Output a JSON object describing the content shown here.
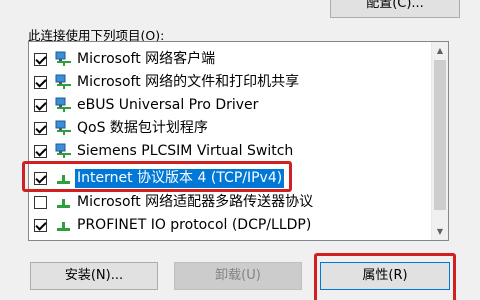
{
  "top_button": {
    "label": "配置(C)..."
  },
  "caption": "此连接使用下列项目(O):",
  "items": [
    {
      "label": "Microsoft 网络客户端",
      "checked": true,
      "icon": "network-client-icon"
    },
    {
      "label": "Microsoft 网络的文件和打印机共享",
      "checked": true,
      "icon": "network-client-icon"
    },
    {
      "label": "eBUS Universal Pro Driver",
      "checked": true,
      "icon": "network-client-icon"
    },
    {
      "label": "QoS 数据包计划程序",
      "checked": true,
      "icon": "network-client-icon"
    },
    {
      "label": "Siemens PLCSIM Virtual Switch",
      "checked": true,
      "icon": "network-client-icon"
    },
    {
      "label": "Internet 协议版本 4 (TCP/IPv4)",
      "checked": true,
      "selected": true,
      "icon": "protocol-icon"
    },
    {
      "label": "Microsoft 网络适配器多路传送器协议",
      "checked": false,
      "icon": "protocol-icon"
    },
    {
      "label": "PROFINET IO protocol (DCP/LLDP)",
      "checked": true,
      "icon": "protocol-icon"
    }
  ],
  "buttons": {
    "install": "安装(N)...",
    "uninstall": "卸载(U)",
    "properties": "属性(R)"
  },
  "colors": {
    "selection": "#0078d7",
    "highlight": "#d02020"
  }
}
